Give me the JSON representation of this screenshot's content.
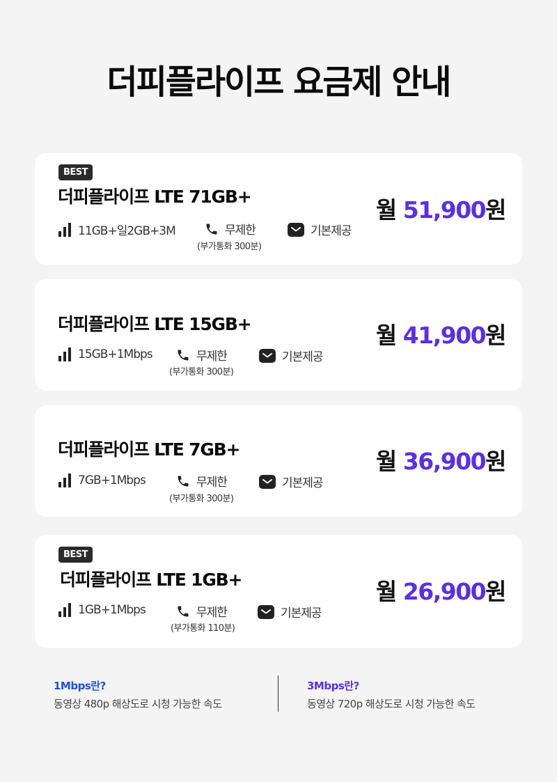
{
  "page_title": "더피플라이프 요금제 안내",
  "plans": [
    {
      "badge": "BEST",
      "name": "더피플라이프 LTE 71GB+",
      "data": "11GB+일2GB+3M",
      "call": "무제한",
      "call_sub": "(부가통화 300분)",
      "sms": "기본제공",
      "price_prefix": "월 ",
      "price_amount": "51,900",
      "price_suffix": "원"
    },
    {
      "badge": "",
      "name": "더피플라이프 LTE 15GB+",
      "data": "15GB+1Mbps",
      "call": "무제한",
      "call_sub": "(부가통화 300분)",
      "sms": "기본제공",
      "price_prefix": "월 ",
      "price_amount": "41,900",
      "price_suffix": "원"
    },
    {
      "badge": "",
      "name": "더피플라이프 LTE 7GB+",
      "data": "7GB+1Mbps",
      "call": "무제한",
      "call_sub": "(부가통화 300분)",
      "sms": "기본제공",
      "price_prefix": "월 ",
      "price_amount": "36,900",
      "price_suffix": "원"
    },
    {
      "badge": "BEST",
      "name": "더피플라이프 LTE 1GB+",
      "data": "1GB+1Mbps",
      "call": "무제한",
      "call_sub": "(부가통화 110분)",
      "sms": "기본제공",
      "price_prefix": "월 ",
      "price_amount": "26,900",
      "price_suffix": "원"
    }
  ],
  "notes": [
    {
      "title": "1Mbps란?",
      "desc": "동영상 480p 해상도로 시청 가능한 속도",
      "color": "#1f4fe0"
    },
    {
      "title": "3Mbps란?",
      "desc": "동영상 720p 해상도로 시청 가능한 속도",
      "color": "#5b2ee8"
    }
  ],
  "colors": {
    "accent": "#5b2ee8",
    "background": "#f4f4f4",
    "card": "#ffffff",
    "badge": "#2b2b2b"
  },
  "icons": {
    "data": "signal-bars-icon",
    "call": "phone-icon",
    "sms": "envelope-icon"
  }
}
